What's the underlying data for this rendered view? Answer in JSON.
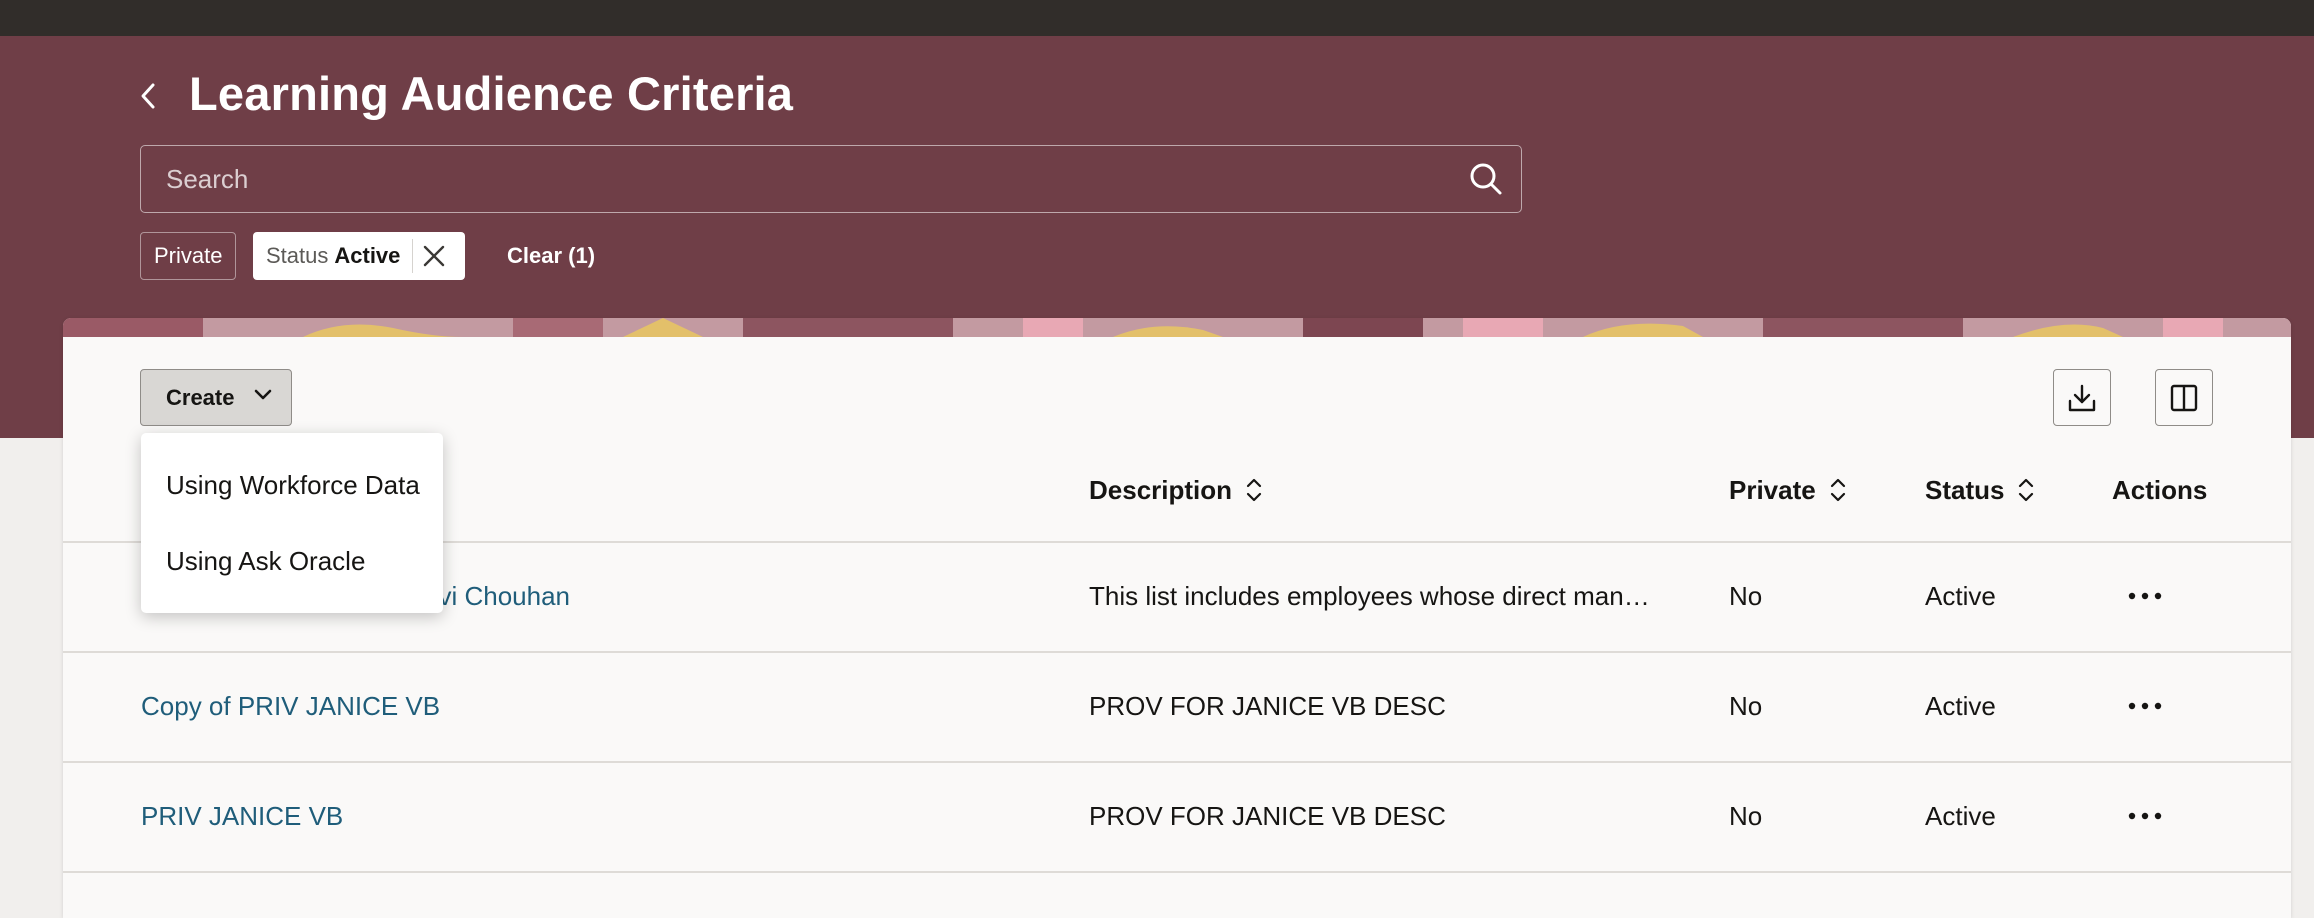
{
  "header": {
    "title": "Learning Audience Criteria",
    "back_icon": "chevron-left-icon"
  },
  "search": {
    "placeholder": "Search",
    "value": "",
    "icon": "search-icon"
  },
  "filters": {
    "private_chip": "Private",
    "status_chip": {
      "label": "Status",
      "value": "Active",
      "remove_icon": "close-icon"
    },
    "clear_label": "Clear (1)"
  },
  "toolbar": {
    "create_label": "Create",
    "create_icon": "chevron-down-icon",
    "export_icon": "download-icon",
    "columns_icon": "columns-icon"
  },
  "create_menu": {
    "items": [
      "Using Workforce Data",
      "Using Ask Oracle"
    ]
  },
  "table": {
    "columns": {
      "description": "Description",
      "private": "Private",
      "status": "Status",
      "actions": "Actions"
    },
    "rows": [
      {
        "name_visible": "avi Chouhan",
        "description": "This list includes employees whose direct manager is Ravi Chouhan",
        "private": "No",
        "status": "Active"
      },
      {
        "name_visible": "Copy of PRIV JANICE VB",
        "description": "PROV FOR JANICE VB DESC",
        "private": "No",
        "status": "Active"
      },
      {
        "name_visible": "PRIV JANICE VB",
        "description": "PROV FOR JANICE VB DESC",
        "private": "No",
        "status": "Active"
      }
    ]
  },
  "colors": {
    "top_bar": "#312d2a",
    "header_band": "#6f3e47",
    "link": "#1f5d7a",
    "page_background": "#f1efed",
    "card_background": "#faf9f8"
  }
}
